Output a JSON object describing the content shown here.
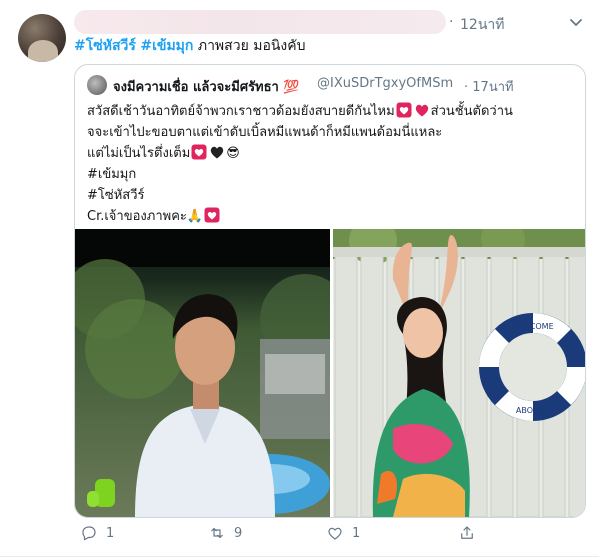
{
  "tweet": {
    "time_sep": "·",
    "time": "12นาที",
    "hashtag1": "#โซ่หัสวีร์",
    "hashtag2": "#เข้มมุก",
    "text_rest": "ภาพสวย มอนิงคับ"
  },
  "quote": {
    "name": "จงมีความเชื่อ แล้วจะมีศรัทธา",
    "name_emoji": "💯",
    "handle": "@IXuSDrTgxyOfMSm",
    "time_sep": "·",
    "time": "17นาที",
    "line1_a": "สวัสดีเช้าวันอาทิตย์จ้าพวกเราชาวด้อมยังสบายดีกันไหม",
    "line1_b": "ส่วนชั้นตัดว่าน",
    "line2": "จจะเข้าไปะขอบตาแต่เข้าดับเบิ้ลหมีแพนด้าก็หมีแพนด้อมนี่แหละ",
    "line3": "แต่ไม่เป็นไรตึ่งเต็ม",
    "line3_emoji": "😎",
    "line4": "#เข้มมุก",
    "line5": "#โซ่หัสวีร์",
    "line6": "Cr.เจ้าของภาพคะ",
    "line6_emoji": "🙏",
    "lifebuoy_text_top": "WELCOME",
    "lifebuoy_text_bottom": "ABOARD"
  },
  "actions": {
    "reply_count": "1",
    "retweet_count": "9",
    "like_count": "1"
  },
  "colors": {
    "accent": "#1da1f2",
    "muted": "#657786",
    "heart_red": "#e0245e",
    "border": "#ccd6dd"
  },
  "icons": [
    "chevron-down-icon",
    "reply-icon",
    "retweet-icon",
    "like-icon",
    "share-icon"
  ]
}
